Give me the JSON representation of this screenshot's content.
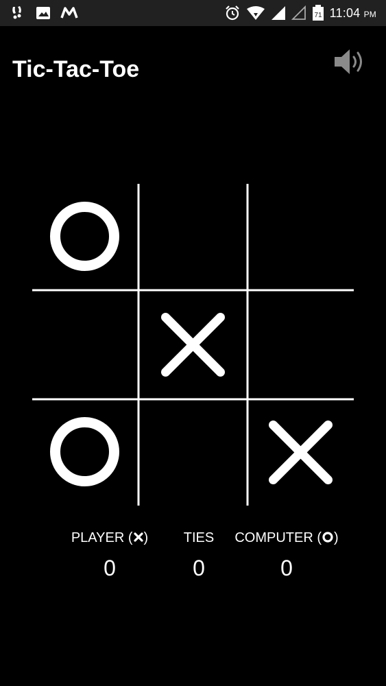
{
  "status_bar": {
    "time": "11:04",
    "ampm": "PM",
    "battery": "71"
  },
  "app": {
    "title": "Tic-Tac-Toe"
  },
  "board": {
    "cells": [
      "O",
      "",
      "",
      "",
      "X",
      "",
      "O",
      "",
      "X"
    ]
  },
  "scoreboard": {
    "player_label": "PLAYER (",
    "player_label_end": ")",
    "ties_label": "TIES",
    "computer_label": "COMPUTER (",
    "computer_label_end": ")",
    "player_score": "0",
    "ties_score": "0",
    "computer_score": "0"
  },
  "icons": {
    "sound": "speaker-icon",
    "player_mark": "x-icon",
    "computer_mark": "o-icon"
  },
  "colors": {
    "background": "#000000",
    "status_bar": "#212121",
    "foreground": "#ffffff",
    "sound_icon": "#8a8a8a"
  }
}
